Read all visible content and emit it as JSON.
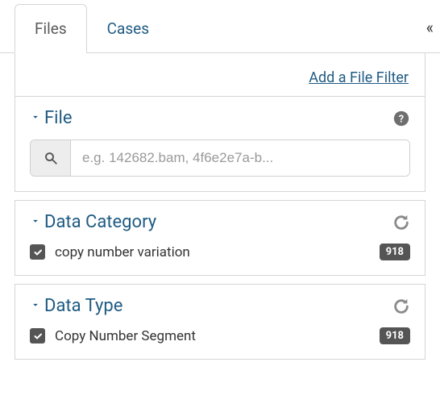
{
  "tabs": {
    "files": "Files",
    "cases": "Cases",
    "collapse_icon": "«"
  },
  "add_filter_link": "Add a File Filter",
  "sections": {
    "file": {
      "title": "File",
      "search_placeholder": "e.g. 142682.bam, 4f6e2e7a-b..."
    },
    "data_category": {
      "title": "Data Category",
      "items": [
        {
          "label": "copy number variation",
          "count": "918",
          "checked": true
        }
      ]
    },
    "data_type": {
      "title": "Data Type",
      "items": [
        {
          "label": "Copy Number Segment",
          "count": "918",
          "checked": true
        }
      ]
    }
  }
}
